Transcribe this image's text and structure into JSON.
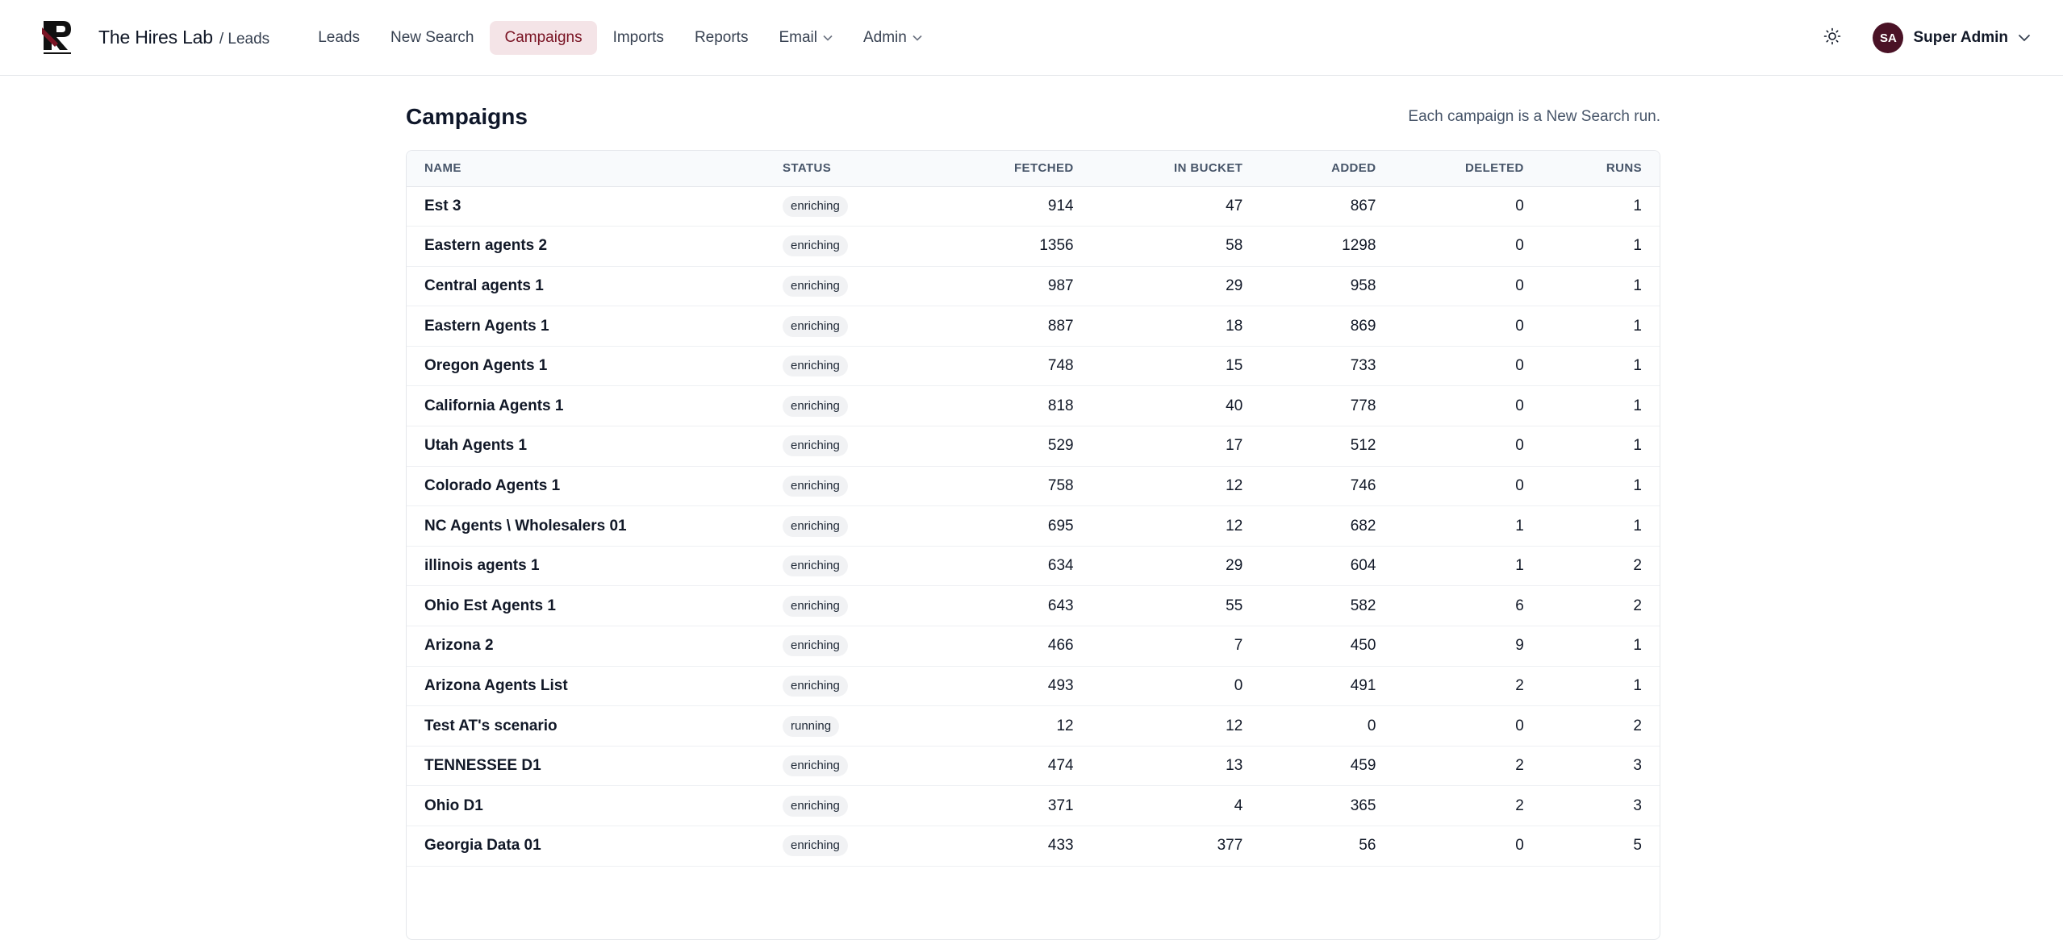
{
  "header": {
    "brand_name": "The Hires Lab",
    "brand_section": "/ Leads",
    "nav": [
      {
        "label": "Leads"
      },
      {
        "label": "New Search"
      },
      {
        "label": "Campaigns"
      },
      {
        "label": "Imports"
      },
      {
        "label": "Reports"
      },
      {
        "label": "Email"
      },
      {
        "label": "Admin"
      }
    ],
    "active_nav": "Campaigns",
    "user": {
      "initials": "SA",
      "name": "Super Admin"
    }
  },
  "page": {
    "title": "Campaigns",
    "subtitle": "Each campaign is a New Search run."
  },
  "table": {
    "columns": [
      "NAME",
      "STATUS",
      "FETCHED",
      "IN BUCKET",
      "ADDED",
      "DELETED",
      "RUNS"
    ],
    "rows": [
      {
        "name": "Est 3",
        "status": "enriching",
        "fetched": "914",
        "in_bucket": "47",
        "added": "867",
        "deleted": "0",
        "runs": "1"
      },
      {
        "name": "Eastern agents 2",
        "status": "enriching",
        "fetched": "1356",
        "in_bucket": "58",
        "added": "1298",
        "deleted": "0",
        "runs": "1"
      },
      {
        "name": "Central agents 1",
        "status": "enriching",
        "fetched": "987",
        "in_bucket": "29",
        "added": "958",
        "deleted": "0",
        "runs": "1"
      },
      {
        "name": "Eastern Agents 1",
        "status": "enriching",
        "fetched": "887",
        "in_bucket": "18",
        "added": "869",
        "deleted": "0",
        "runs": "1"
      },
      {
        "name": "Oregon Agents 1",
        "status": "enriching",
        "fetched": "748",
        "in_bucket": "15",
        "added": "733",
        "deleted": "0",
        "runs": "1"
      },
      {
        "name": "California Agents 1",
        "status": "enriching",
        "fetched": "818",
        "in_bucket": "40",
        "added": "778",
        "deleted": "0",
        "runs": "1"
      },
      {
        "name": "Utah Agents 1",
        "status": "enriching",
        "fetched": "529",
        "in_bucket": "17",
        "added": "512",
        "deleted": "0",
        "runs": "1"
      },
      {
        "name": "Colorado Agents 1",
        "status": "enriching",
        "fetched": "758",
        "in_bucket": "12",
        "added": "746",
        "deleted": "0",
        "runs": "1"
      },
      {
        "name": "NC Agents \\ Wholesalers 01",
        "status": "enriching",
        "fetched": "695",
        "in_bucket": "12",
        "added": "682",
        "deleted": "1",
        "runs": "1"
      },
      {
        "name": "illinois agents 1",
        "status": "enriching",
        "fetched": "634",
        "in_bucket": "29",
        "added": "604",
        "deleted": "1",
        "runs": "2"
      },
      {
        "name": "Ohio Est Agents 1",
        "status": "enriching",
        "fetched": "643",
        "in_bucket": "55",
        "added": "582",
        "deleted": "6",
        "runs": "2"
      },
      {
        "name": "Arizona 2",
        "status": "enriching",
        "fetched": "466",
        "in_bucket": "7",
        "added": "450",
        "deleted": "9",
        "runs": "1"
      },
      {
        "name": "Arizona Agents List",
        "status": "enriching",
        "fetched": "493",
        "in_bucket": "0",
        "added": "491",
        "deleted": "2",
        "runs": "1"
      },
      {
        "name": "Test AT's scenario",
        "status": "running",
        "fetched": "12",
        "in_bucket": "12",
        "added": "0",
        "deleted": "0",
        "runs": "2"
      },
      {
        "name": "TENNESSEE D1",
        "status": "enriching",
        "fetched": "474",
        "in_bucket": "13",
        "added": "459",
        "deleted": "2",
        "runs": "3"
      },
      {
        "name": "Ohio D1",
        "status": "enriching",
        "fetched": "371",
        "in_bucket": "4",
        "added": "365",
        "deleted": "2",
        "runs": "3"
      },
      {
        "name": "Georgia Data 01",
        "status": "enriching",
        "fetched": "433",
        "in_bucket": "377",
        "added": "56",
        "deleted": "0",
        "runs": "5"
      }
    ]
  },
  "colors": {
    "accent": "#7a1424",
    "accent_bg": "#f4e4e7",
    "avatar_bg": "#4a1226"
  }
}
